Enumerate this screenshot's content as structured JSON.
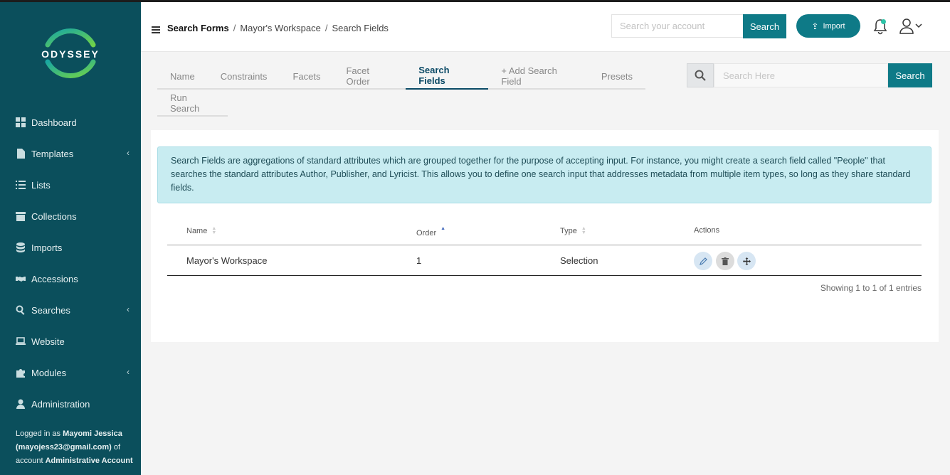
{
  "app": {
    "logo_text": "ODYSSEY",
    "brand_colors": {
      "primary": "#0b4f5c",
      "accent": "#0e7a87",
      "ring_green": "#3cc36a",
      "ring_teal": "#1aa7a1"
    }
  },
  "sidebar": {
    "items": [
      {
        "label": "Dashboard",
        "icon": "dashboard-icon",
        "has_submenu": false
      },
      {
        "label": "Templates",
        "icon": "file-icon",
        "has_submenu": true
      },
      {
        "label": "Lists",
        "icon": "list-icon",
        "has_submenu": false
      },
      {
        "label": "Collections",
        "icon": "archive-icon",
        "has_submenu": false
      },
      {
        "label": "Imports",
        "icon": "database-icon",
        "has_submenu": false
      },
      {
        "label": "Accessions",
        "icon": "handshake-icon",
        "has_submenu": false
      },
      {
        "label": "Searches",
        "icon": "search-icon",
        "has_submenu": true
      },
      {
        "label": "Website",
        "icon": "laptop-icon",
        "has_submenu": false
      },
      {
        "label": "Modules",
        "icon": "puzzle-icon",
        "has_submenu": true
      },
      {
        "label": "Administration",
        "icon": "user-icon",
        "has_submenu": false
      }
    ],
    "chevron": "‹",
    "login": {
      "prefix": "Logged in as ",
      "user": "Mayomi Jessica",
      "email": "(mayojess23@gmail.com)",
      "of_account": " of account ",
      "account": "Administrative Account"
    }
  },
  "header": {
    "breadcrumb": [
      "Search Forms",
      "Mayor's Workspace",
      "Search Fields"
    ],
    "breadcrumb_sep": "/",
    "account_search_placeholder": "Search your account",
    "account_search_button": "Search",
    "import_button": "Import"
  },
  "tabs": {
    "row1": [
      "Name",
      "Constraints",
      "Facets",
      "Facet Order",
      "Search Fields",
      "+ Add Search Field",
      "Presets"
    ],
    "row2": [
      "Run Search"
    ],
    "active": "Search Fields"
  },
  "search_here": {
    "placeholder": "Search Here",
    "button": "Search"
  },
  "info_text": "Search Fields are aggregations of standard attributes which are grouped together for the purpose of accepting input. For instance, you might create a search field called \"People\" that searches the standard attributes Author, Publisher, and Lyricist. This allows you to define one search input that addresses metadata from multiple item types, so long as they share standard fields.",
  "table": {
    "columns": [
      "Name",
      "Order",
      "Type",
      "Actions"
    ],
    "rows": [
      {
        "name": "Mayor's Workspace",
        "order": "1",
        "type": "Selection"
      }
    ],
    "actions": [
      "edit-icon",
      "trash-icon",
      "move-icon"
    ],
    "footer": "Showing 1 to 1 of 1 entries"
  }
}
